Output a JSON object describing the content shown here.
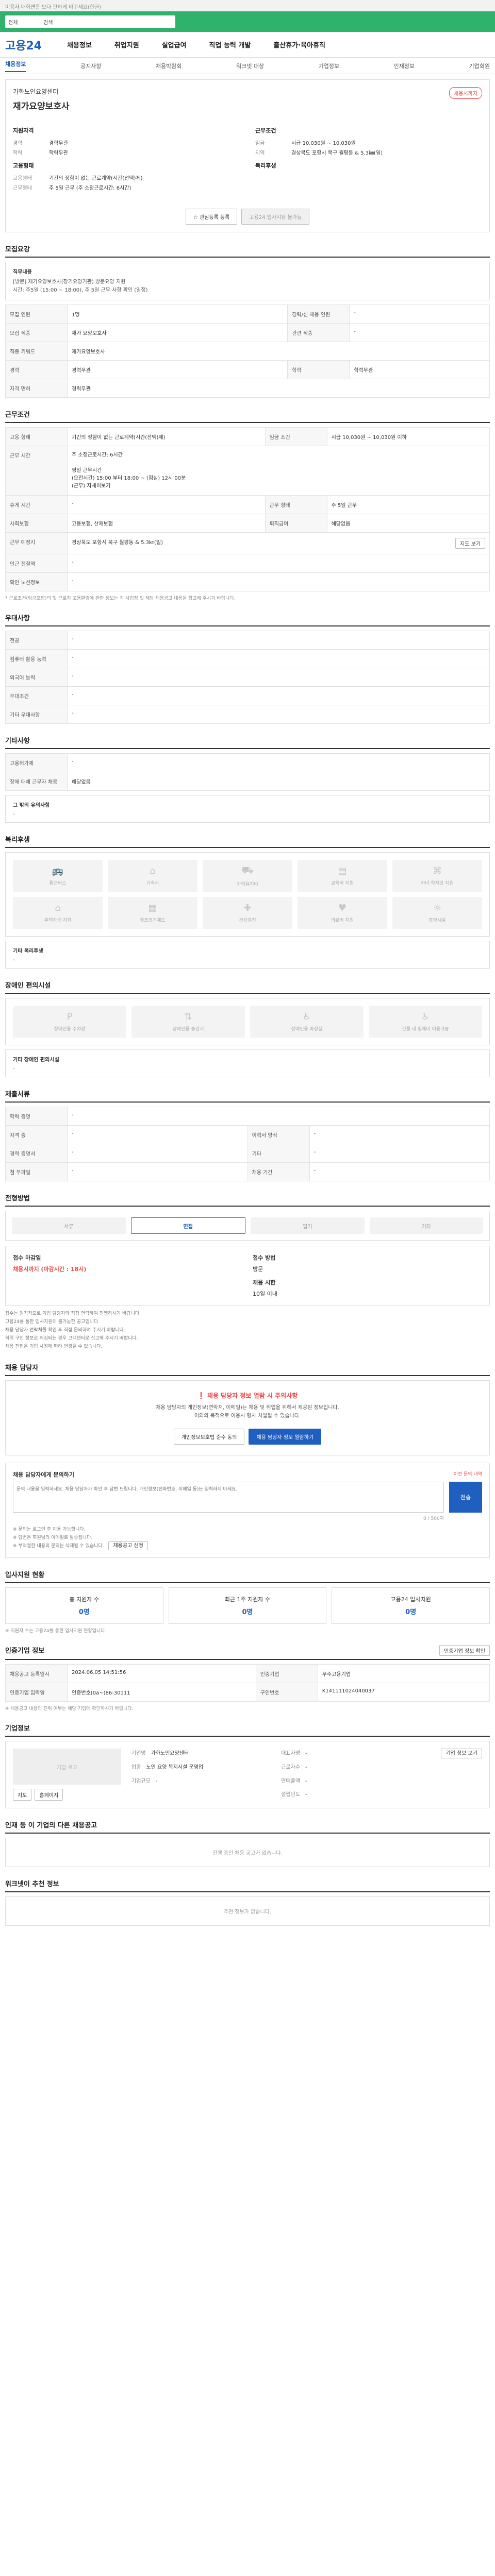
{
  "topnote": "이용자 대화면은 보다 편하게 바꾸세요(한글)",
  "search": {
    "category": "전체",
    "placeholder": "검색"
  },
  "logo": "고용24",
  "gnb": [
    "채용정보",
    "취업지원",
    "실업급여",
    "직업 능력 개발",
    "출산휴가·육아휴직"
  ],
  "subnav": [
    "채용정보",
    "공지사항",
    "채용박람회",
    "워크넷 대상",
    "기업정보",
    "인재정보",
    "기업회원"
  ],
  "job": {
    "company": "가화노인요양센터",
    "title": "재가요양보호사",
    "badge": "채용시까지",
    "left_title": "지원자격",
    "left": [
      {
        "k": "경력",
        "v": "경력무관"
      },
      {
        "k": "학력",
        "v": "학력무관"
      }
    ],
    "type_title": "고용형태",
    "type": [
      {
        "k": "고용형태",
        "v": "기간의 정함이 없는 근로계약(시간(선택)제)"
      },
      {
        "k": "근무형태",
        "v": "주 5일 근무 (주 소정근로시간: 6시간)"
      }
    ],
    "right_title": "근무조건",
    "right": [
      {
        "k": "임금",
        "v": "시급 10,030원 ~ 10,030원"
      },
      {
        "k": "지역",
        "v": "경상북도 포항시 북구 월평동 & 5.3㎞(일)"
      }
    ],
    "welfare_title": "복리후생",
    "btn_interest": "관심등록 등록",
    "btn_apply": "고용24 입사지원 불가능"
  },
  "content": {
    "title": "모집요강",
    "duty_title": "직무내용",
    "duty": "[방문] 재가요양보호사(장기요양기관) 방문요양 지원\n시간: 주5일 (15:00 ~ 18:00), 주 5일 근무 사항 확인 (일정)",
    "rows": [
      {
        "k": "모집 인원",
        "v": "1명",
        "k2": "경력/신 채용 인원",
        "v2": "-"
      },
      {
        "k": "모집 직종",
        "v": "재가 요양보호사",
        "k2": "관련 직종",
        "v2": "-"
      },
      {
        "k": "직종 키워드",
        "v": "재가요양보호사",
        "k2": "",
        "v2": ""
      },
      {
        "k": "경력",
        "v": "경력무관",
        "k2": "학력",
        "v2": "학력무관"
      },
      {
        "k": "자격 면허",
        "v": "경력무관",
        "k2": "",
        "v2": ""
      }
    ]
  },
  "conditions": {
    "title": "근무조건",
    "rows": [
      {
        "k": "고용 형태",
        "v": "기간의 정함이 없는 근로계약(시간(선택)제)",
        "k2": "임금 조건",
        "v2": "시급 10,030원 ~ 10,030원 이하"
      },
      {
        "k": "근무 시간",
        "v": "주 소정근로시간: 6시간\n\n평일 근무시간\n(오전시간) 15:00 부터 18:00 ~ (점심) 12시 00분\n(근무) 자세히보기",
        "k2": "",
        "v2": ""
      },
      {
        "k": "휴게 시간",
        "v": "-",
        "k2": "근무 형태",
        "v2": "주 5일 근무"
      },
      {
        "k": "사회보험",
        "v": "고용보험, 산재보험",
        "k2": "퇴직급여",
        "v2": "해당없음"
      },
      {
        "k": "근무 예정지",
        "v": "경상북도 포항시 북구 월평동 & 5.3㎞(일)",
        "k2": "",
        "v2": ""
      },
      {
        "k": "인근 전철역",
        "v": "-",
        "k2": "",
        "v2": ""
      },
      {
        "k": "확인 노선정보",
        "v": "-",
        "k2": "",
        "v2": ""
      }
    ],
    "map_btn": "지도 보기",
    "note": "* 근로조건(임금포함)의 및 근로자 고용환경에 관한 정보는 각 사업장 및 해당 채용공고 내용을 참고해 주시기 바랍니다."
  },
  "preference": {
    "title": "우대사항",
    "rows": [
      {
        "k": "전공",
        "v": "-"
      },
      {
        "k": "컴퓨터 활용 능력",
        "v": "-"
      },
      {
        "k": "외국어 능력",
        "v": "-"
      },
      {
        "k": "우대조건",
        "v": "-"
      },
      {
        "k": "기타 우대사항",
        "v": "-"
      }
    ]
  },
  "etc": {
    "title": "기타사항",
    "rows": [
      {
        "k": "고용허가제",
        "v": "-"
      },
      {
        "k": "장애 대체 근무자 채용",
        "v": "해당없음"
      }
    ],
    "box_title": "그 밖의 유의사항",
    "box_value": "-"
  },
  "welfare": {
    "title": "복리후생",
    "items": [
      "통근버스",
      "기숙사",
      "차량유지비",
      "교육비 지원",
      "자녀 학자금 지원",
      "주택자금 지원",
      "경조휴가제도",
      "건강검진",
      "의료비 지원",
      "휴양시설"
    ],
    "box_title": "기타 복리후생",
    "box_value": "-"
  },
  "disability": {
    "title": "장애인 편의시설",
    "items": [
      "장애인용 주차장",
      "장애인용 승강기",
      "장애인용 화장실",
      "건물 내 휠체어 이용가능"
    ],
    "box_title": "기타 장애인 편의시설",
    "box_value": "-"
  },
  "docs": {
    "title": "제출서류",
    "rows": [
      {
        "k": "학력 증명",
        "v": "-",
        "k2": "",
        "v2": ""
      },
      {
        "k": "자격 증",
        "v": "-",
        "k2": "이력서 양식",
        "v2": "-"
      },
      {
        "k": "경력 증명서",
        "v": "-",
        "k2": "기타",
        "v2": "-"
      },
      {
        "k": "첨 부파일",
        "v": "-",
        "k2": "채용 기간",
        "v2": "-"
      }
    ]
  },
  "method": {
    "title": "전형방법",
    "items": [
      "서류",
      "면접",
      "필기",
      "기타"
    ],
    "active": 1,
    "deadline_label": "접수 마감일",
    "deadline_value": "채용시까지 (마감시간 : 18시)",
    "apply_label": "접수 방법",
    "apply_value": "방문",
    "cost_label": "채용 시한",
    "cost_value": "10일 이내",
    "bullets": [
      "접수는 원칙적으로 기업 담당자와 직접 연락하여 진행하시기 바랍니다.",
      "고용24를 통한 입사지원이 불가능한 공고입니다.",
      "채용 담당자 연락처를 확인 후 직접 문의하여 주시기 바랍니다.",
      "허위 구인 정보로 의심되는 경우 고객센터로 신고해 주시기 바랍니다.",
      "채용 전형은 기업 사정에 따라 변경될 수 있습니다."
    ]
  },
  "contact": {
    "title": "채용 담당자",
    "warn": "채용 담당자 정보 열람 시 주의사항",
    "desc": "채용 담당자의 개인정보(연락처, 이메일)는 채용 및 취업을 위해서 제공된 정보입니다.\n이외의 목적으로 이용시 형사 처벌될 수 있습니다.",
    "btn_agree": "개인정보보호법 준수 동의",
    "btn_view": "채용 담당자 정보 열람하기"
  },
  "inquiry": {
    "title": "채용 담당자에게 문의하기",
    "sub": "이전 문의 내역",
    "placeholder": "문의 내용을 입력하세요. 채용 담당자가 확인 후 답변 드립니다. 개인정보(전화번호, 이메일 등)는 입력하지 마세요.",
    "count": "0 / 500자",
    "send": "전송",
    "note1": "※ 문의는 로그인 후 이용 가능합니다.",
    "note2": "※ 답변은 회원님의 이메일로 발송됩니다.",
    "note3": "※ 부적절한 내용의 문의는 삭제될 수 있습니다.",
    "apply_btn": "채용공고 신청"
  },
  "status": {
    "title": "입사지원 현황",
    "items": [
      {
        "label": "총 지원자 수",
        "value": "0명"
      },
      {
        "label": "최근 1주 지원자 수",
        "value": "0명"
      },
      {
        "label": "고용24 입사지원",
        "value": "0명"
      }
    ],
    "note": "※ 지원자 수는 고용24를 통한 입사지원 현황입니다."
  },
  "info": {
    "title": "인증기업 정보",
    "btn": "인증기업 정보 확인",
    "rows": [
      {
        "k": "채용공고 등록일시",
        "v": "2024.06.05 14:51:56",
        "k2": "인증기업",
        "v2": "우수고용기업"
      },
      {
        "k": "인증기업 입력일",
        "v": "인증번호(0a~)86-30111",
        "k2": "구인번호",
        "v2": "K141111024040037"
      }
    ],
    "note": "※ 채용공고 내용의 진위 여부는 해당 기업에 확인하시기 바랍니다."
  },
  "corp": {
    "title": "기업정보",
    "logo_alt": "기업 로고",
    "btn_detail": "기업 정보 보기",
    "btn_map": "지도",
    "btn_home": "홈페이지",
    "rows": [
      {
        "k": "기업명",
        "v": "가화노인요양센터"
      },
      {
        "k": "업종",
        "v": "노인 요양 복지시설 운영업"
      },
      {
        "k": "대표자명",
        "v": "-"
      },
      {
        "k": "근로자수",
        "v": "-"
      },
      {
        "k": "연매출액",
        "v": "-"
      },
      {
        "k": "설립년도",
        "v": "-"
      },
      {
        "k": "기업규모",
        "v": "-"
      }
    ]
  },
  "other_jobs": {
    "title": "인재 등 이 기업의 다른 채용공고",
    "empty": "진행 중인 채용 공고가 없습니다."
  },
  "recommend": {
    "title": "워크넷이 추천 정보",
    "empty": "추천 정보가 없습니다."
  }
}
